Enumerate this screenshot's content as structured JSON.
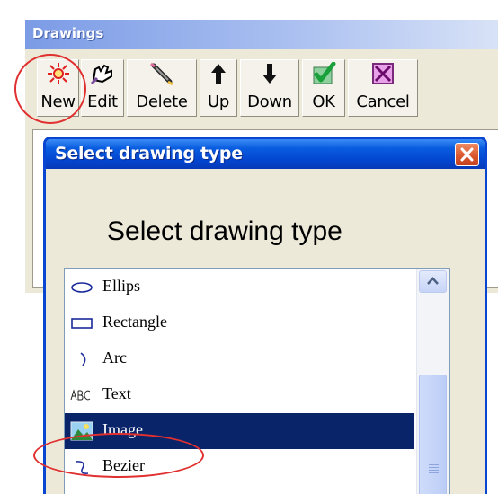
{
  "drawings_window": {
    "title": "Drawings",
    "toolbar": [
      {
        "id": "new",
        "label": "New",
        "icon": "new-sun-icon"
      },
      {
        "id": "edit",
        "label": "Edit",
        "icon": "edit-hand-icon"
      },
      {
        "id": "delete",
        "label": "Delete",
        "icon": "delete-pen-icon"
      },
      {
        "id": "up",
        "label": "Up",
        "icon": "up-arrow-icon"
      },
      {
        "id": "down",
        "label": "Down",
        "icon": "down-arrow-icon"
      },
      {
        "id": "ok",
        "label": "OK",
        "icon": "checkmark-icon"
      },
      {
        "id": "cancel",
        "label": "Cancel",
        "icon": "cancel-x-icon"
      }
    ]
  },
  "dialog": {
    "title": "Select drawing type",
    "heading": "Select drawing type",
    "list_items": [
      {
        "label": "Ellips",
        "icon": "ellipse-icon",
        "selected": false
      },
      {
        "label": "Rectangle",
        "icon": "rectangle-icon",
        "selected": false
      },
      {
        "label": "Arc",
        "icon": "arc-icon",
        "selected": false
      },
      {
        "label": "Text",
        "icon": "text-abc-icon",
        "selected": false
      },
      {
        "label": "Image",
        "icon": "image-icon",
        "selected": true
      },
      {
        "label": "Bezier",
        "icon": "bezier-icon",
        "selected": false
      }
    ]
  },
  "colors": {
    "selection": "#0a246a",
    "dialog_title": "#0346d0",
    "annotation_red": "#e03030"
  }
}
